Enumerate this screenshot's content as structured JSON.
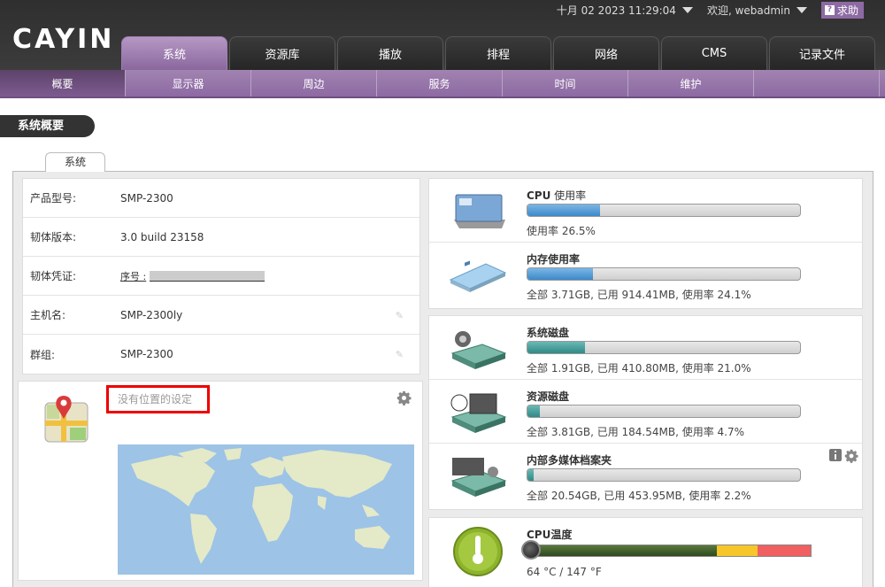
{
  "header": {
    "logo": "CAYIN",
    "datetime": "十月 02 2023 11:29:04",
    "welcome": "欢迎, webadmin",
    "help_label": "求助",
    "help_glyph": "?"
  },
  "tabs": [
    "系统",
    "资源库",
    "播放",
    "排程",
    "网络",
    "CMS",
    "记录文件"
  ],
  "subnav": [
    "概要",
    "显示器",
    "周边",
    "服务",
    "时间",
    "维护",
    ""
  ],
  "page_title": "系统概要",
  "section_tab": "系统",
  "info": {
    "rows": [
      {
        "label": "产品型号:",
        "value": "SMP-2300"
      },
      {
        "label": "韧体版本:",
        "value": "3.0 build 23158"
      },
      {
        "label": "韧体凭证:",
        "value": "序号 :"
      },
      {
        "label": "主机名:",
        "value": "SMP-2300ly"
      },
      {
        "label": "群组:",
        "value": "SMP-2300"
      }
    ]
  },
  "location": {
    "status": "没有位置的设定"
  },
  "monitors": {
    "cpu": {
      "title": "CPU",
      "title_sub": " 使用率",
      "percent": 26.5,
      "text": "使用率 26.5%"
    },
    "memory": {
      "title": "内存使用率",
      "percent": 24.1,
      "text": "全部 3.71GB, 已用 914.41MB, 使用率 24.1%"
    },
    "system_disk": {
      "title": "系统磁盘",
      "percent": 21.0,
      "text": "全部 1.91GB, 已用 410.80MB, 使用率 21.0%"
    },
    "resource_disk": {
      "title": "资源磁盘",
      "percent": 4.7,
      "text": "全部 3.81GB, 已用 184.54MB, 使用率 4.7%"
    },
    "internal_media": {
      "title": "内部多媒体档案夹",
      "percent": 2.2,
      "text": "全部 20.54GB, 已用 453.95MB, 使用率 2.2%"
    },
    "cpu_temp": {
      "title": "CPU温度",
      "text": "64 °C / 147 °F"
    }
  },
  "colors": {
    "accent": "#8d6aa3",
    "bar_blue": "#3d89c8",
    "bar_teal": "#2f8a87",
    "highlight_red": "#e00000"
  }
}
